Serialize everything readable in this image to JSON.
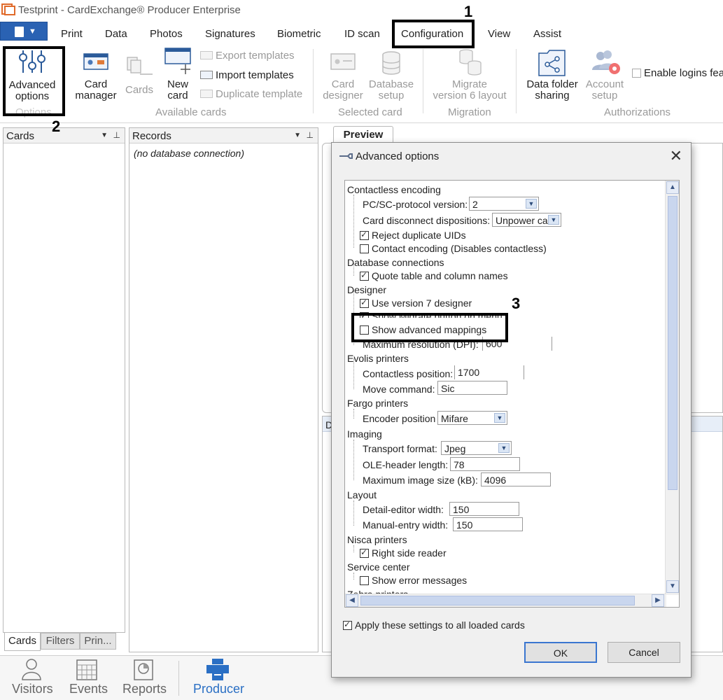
{
  "window": {
    "title": "Testprint - CardExchange® Producer Enterprise"
  },
  "menu": {
    "items": [
      "Print",
      "Data",
      "Photos",
      "Signatures",
      "Biometric",
      "ID scan",
      "Configuration",
      "View",
      "Assist"
    ]
  },
  "ribbon": {
    "advanced_options": "Advanced options",
    "advanced_options_l1": "Advanced",
    "advanced_options_l2": "options",
    "options_group": "Options",
    "card_manager_l1": "Card",
    "card_manager_l2": "manager",
    "cards": "Cards",
    "new_card_l1": "New",
    "new_card_l2": "card",
    "export_templates": "Export templates",
    "import_templates": "Import templates",
    "duplicate_template": "Duplicate template",
    "available_cards_group": "Available cards",
    "card_designer_l1": "Card",
    "card_designer_l2": "designer",
    "database_setup_l1": "Database",
    "database_setup_l2": "setup",
    "selected_card_group": "Selected card",
    "migrate_l1": "Migrate",
    "migrate_l2": "version 6 layout",
    "migration_group": "Migration",
    "data_folder_l1": "Data folder",
    "data_folder_l2": "sharing",
    "account_setup_l1": "Account",
    "account_setup_l2": "setup",
    "authorizations_group": "Authorizations",
    "enable_logins": "Enable logins fea"
  },
  "panels": {
    "cards_title": "Cards",
    "records_title": "Records",
    "records_empty": "(no database connection)",
    "preview_tab": "Preview",
    "bottom_tabs": [
      "Cards",
      "Filters",
      "Prin..."
    ],
    "d_label": "D"
  },
  "bottom_nav": [
    "Visitors",
    "Events",
    "Reports",
    "Producer"
  ],
  "dialog": {
    "title": "Advanced options",
    "sections": {
      "contactless": "Contactless encoding",
      "pcsc_label": "PC/SC-protocol version:",
      "pcsc_value": "2",
      "disconnect_label": "Card disconnect dispositions:",
      "disconnect_value": "Unpower ca",
      "reject_dup": "Reject duplicate UIDs",
      "contact_enc": "Contact encoding (Disables contactless)",
      "database": "Database connections",
      "quote_names": "Quote table and column names",
      "designer": "Designer",
      "use_v7": "Use version 7 designer",
      "show_migrate": "Show Migrate button on menu",
      "show_adv_map": "Show advanced mappings",
      "max_res_label": "Maximum resolution (DPI):",
      "max_res_value": "600",
      "evolis": "Evolis printers",
      "contactless_pos_label": "Contactless position:",
      "contactless_pos_value": "1700",
      "move_cmd_label": "Move command:",
      "move_cmd_value": "Sic",
      "fargo": "Fargo printers",
      "encoder_pos_label": "Encoder position",
      "encoder_pos_value": "Mifare",
      "imaging": "Imaging",
      "transport_label": "Transport format:",
      "transport_value": "Jpeg",
      "ole_label": "OLE-header length:",
      "ole_value": "78",
      "max_img_label": "Maximum image size (kB):",
      "max_img_value": "4096",
      "layout": "Layout",
      "detail_label": "Detail-editor width:",
      "detail_value": "150",
      "manual_label": "Manual-entry width:",
      "manual_value": "150",
      "nisca": "Nisca printers",
      "right_reader": "Right side reader",
      "service": "Service center",
      "show_errors": "Show error messages",
      "zebra": "Zebra printers"
    },
    "apply_all": "Apply these settings to all loaded cards",
    "ok": "OK",
    "cancel": "Cancel"
  },
  "annotations": [
    "1",
    "2",
    "3"
  ]
}
